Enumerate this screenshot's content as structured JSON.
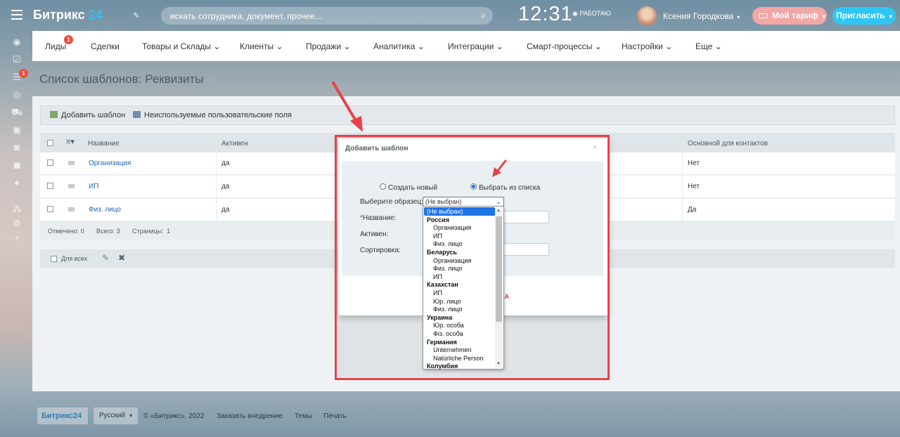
{
  "header": {
    "logo_name": "Битрикс",
    "logo_num": "24",
    "search_placeholder": "искать сотрудника, документ, прочее...",
    "clock": "12:31",
    "work_status": "РАБОТАЮ",
    "user_name": "Ксения Городкова",
    "tariff_label": "Мой тариф",
    "invite_label": "Пригласить"
  },
  "sidebar": {
    "badge": "1"
  },
  "menu": {
    "badge": "1",
    "items": [
      "Лиды",
      "Сделки",
      "Товары и Склады",
      "Клиенты",
      "Продажи",
      "Аналитика",
      "Интеграции",
      "Смарт-процессы",
      "Настройки",
      "Еще"
    ]
  },
  "page": {
    "title": "Список шаблонов: Реквизиты"
  },
  "toolbar": {
    "add_template": "Добавить шаблон",
    "unused_fields": "Неиспользуемые пользовательские поля"
  },
  "grid": {
    "columns": [
      "Название",
      "Активен",
      "Основной для контактов"
    ],
    "rows": [
      {
        "name": "Организация",
        "active": "да",
        "main": "Нет"
      },
      {
        "name": "ИП",
        "active": "да",
        "main": "Нет"
      },
      {
        "name": "Физ. лицо",
        "active": "да",
        "main": "Да"
      }
    ],
    "footer": {
      "marked": "Отмечено: 0",
      "total": "Всего: 3",
      "pages": "Страницы:",
      "page_num": "1"
    },
    "for_all": "Для всех"
  },
  "dialog": {
    "title": "Добавить шаблон",
    "radio_create": "Создать новый",
    "radio_choose": "Выбрать из списка",
    "label_sample": "Выберите образец:",
    "label_name": "Название:",
    "label_active": "Активен:",
    "label_sort": "Сортировка:",
    "required_mark": "*",
    "selected_value": "(Не выбран)",
    "cancel_fragment": "НА",
    "options": [
      {
        "text": "(Не выбран)",
        "kind": "sel"
      },
      {
        "text": "Россия",
        "kind": "grp"
      },
      {
        "text": "Организация",
        "kind": "child"
      },
      {
        "text": "ИП",
        "kind": "child"
      },
      {
        "text": "Физ. лицо",
        "kind": "child"
      },
      {
        "text": "Беларусь",
        "kind": "grp"
      },
      {
        "text": "Организация",
        "kind": "child"
      },
      {
        "text": "Физ. лицо",
        "kind": "child"
      },
      {
        "text": "ИП",
        "kind": "child"
      },
      {
        "text": "Казахстан",
        "kind": "grp"
      },
      {
        "text": "ИП",
        "kind": "child"
      },
      {
        "text": "Юр. лицо",
        "kind": "child"
      },
      {
        "text": "Физ. лицо",
        "kind": "child"
      },
      {
        "text": "Украина",
        "kind": "grp"
      },
      {
        "text": "Юр. особа",
        "kind": "child"
      },
      {
        "text": "Фіз. особа",
        "kind": "child"
      },
      {
        "text": "Германия",
        "kind": "grp"
      },
      {
        "text": "Unternehmen",
        "kind": "child"
      },
      {
        "text": "Natürliche Person",
        "kind": "child"
      },
      {
        "text": "Колумбия",
        "kind": "grp"
      }
    ]
  },
  "footer": {
    "logo": "Битрикс24",
    "lang": "Русский",
    "copyright": "© «Битрикс», 2022",
    "order": "Заказать внедрение",
    "themes": "Темы",
    "print": "Печать"
  },
  "colors": {
    "accent": "#2fc6f6",
    "highlight": "#e8404a",
    "tariff": "#f2a7a7"
  }
}
